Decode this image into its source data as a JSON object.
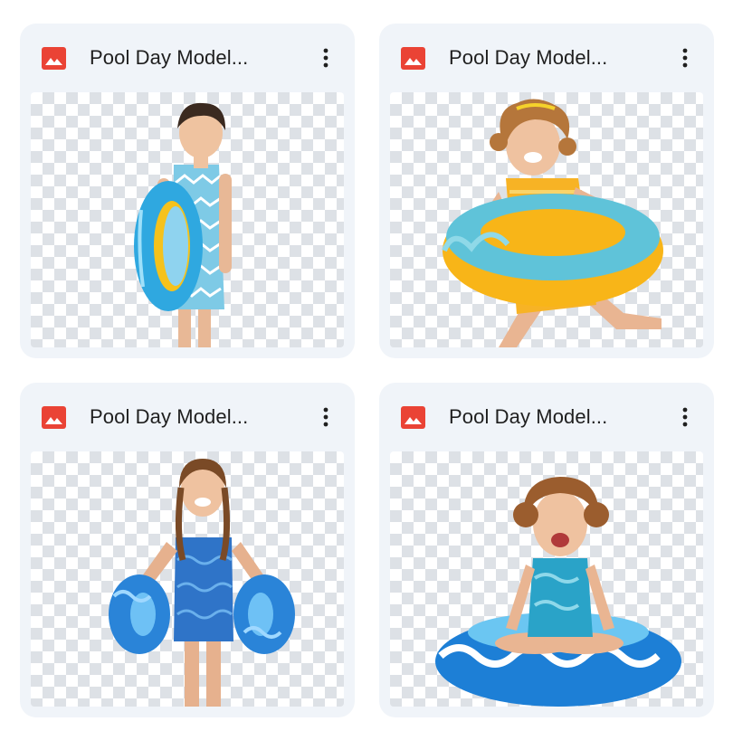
{
  "files": [
    {
      "title": "Pool Day Model..."
    },
    {
      "title": "Pool Day Model..."
    },
    {
      "title": "Pool Day Model..."
    },
    {
      "title": "Pool Day Model..."
    }
  ],
  "colors": {
    "card_bg": "#f0f4f9",
    "image_icon_red": "#ea4335",
    "title_text": "#1f1f1f",
    "checker": "#dde1e6"
  },
  "icons": {
    "file_type": "image-file-icon",
    "more": "more-vert-icon"
  }
}
